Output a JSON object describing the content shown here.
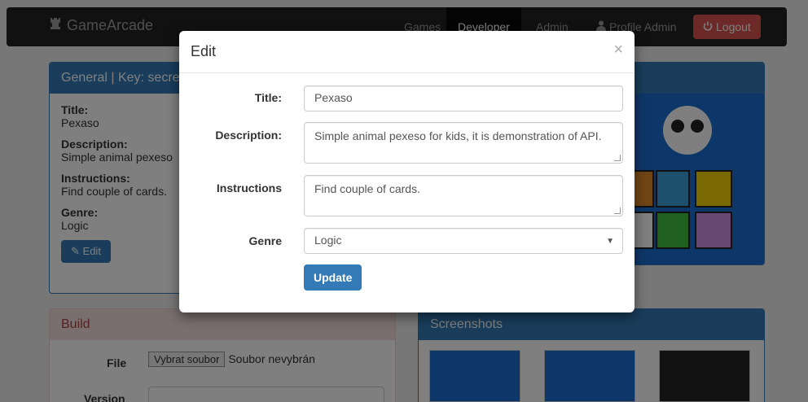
{
  "navbar": {
    "brand": "GameArcade",
    "items": [
      {
        "label": "Games"
      },
      {
        "label": "Developer"
      },
      {
        "label": "Admin"
      },
      {
        "label": "Profile Admin"
      }
    ],
    "logout": "Logout"
  },
  "general_panel": {
    "heading": "General | Key: secre",
    "title_label": "Title:",
    "title_value": "Pexaso",
    "description_label": "Description:",
    "description_value": "Simple animal pexeso",
    "instructions_label": "Instructions:",
    "instructions_value": "Find couple of cards.",
    "genre_label": "Genre:",
    "genre_value": "Logic",
    "edit_button": "Edit"
  },
  "build_panel": {
    "heading": "Build",
    "file_label": "File",
    "file_button": "Vybrat soubor",
    "file_status": "Soubor nevybrán",
    "version_label": "Version"
  },
  "screenshots_panel": {
    "heading": "Screenshots"
  },
  "modal": {
    "title": "Edit",
    "close": "×",
    "fields": {
      "title_label": "Title:",
      "title_value": "Pexaso",
      "description_label": "Description:",
      "description_value": "Simple animal pexeso for kids, it is demonstration of API.",
      "instructions_label": "Instructions",
      "instructions_value": "Find couple of cards.",
      "genre_label": "Genre",
      "genre_value": "Logic"
    },
    "update_button": "Update"
  }
}
